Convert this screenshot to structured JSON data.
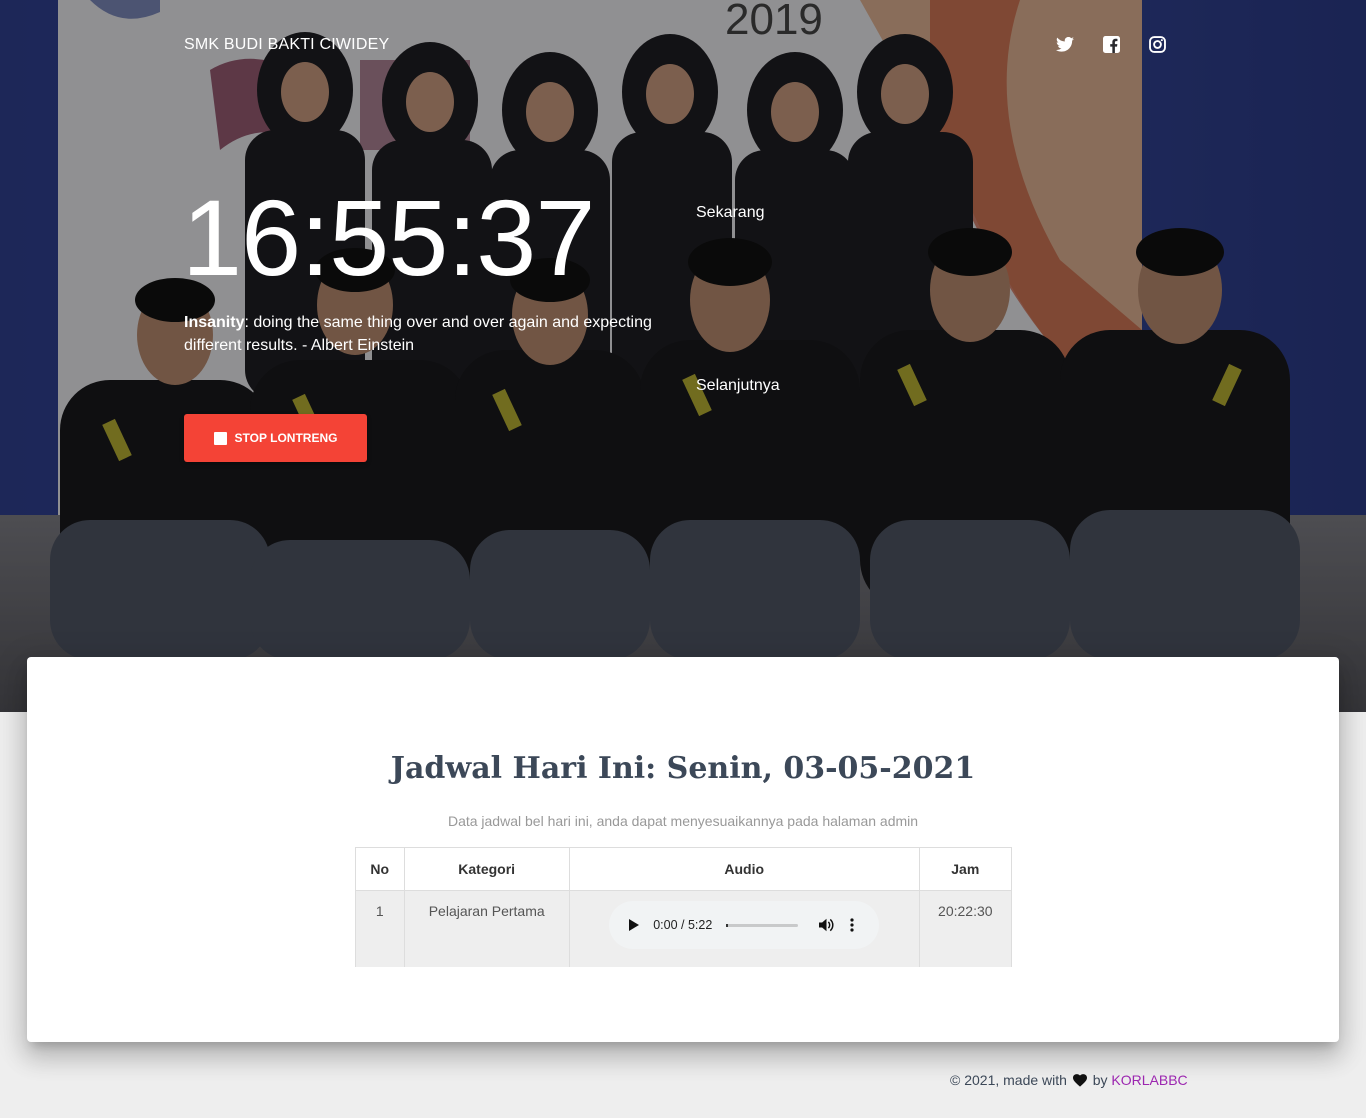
{
  "navbar": {
    "brand": "SMK BUDI BAKTI CIWIDEY",
    "social": [
      {
        "icon": "twitter-icon"
      },
      {
        "icon": "facebook-icon"
      },
      {
        "icon": "instagram-icon"
      }
    ]
  },
  "hero": {
    "background_image": "group photo of students in black uniforms in front of a banner reading 2019",
    "banner_year": "2019",
    "clock": "16:55:37",
    "label_now": "Sekarang",
    "label_next": "Selanjutnya",
    "quote": {
      "term": "Insanity",
      "text": ": doing the same thing over and over again and expecting different results. - Albert Einstein"
    },
    "stop_button": {
      "icon": "stop-icon",
      "label": "STOP LONTRENG",
      "color": "#f44336"
    }
  },
  "schedule": {
    "title": "Jadwal Hari Ini: Senin, 03-05-2021",
    "description": "Data jadwal bel hari ini, anda dapat menyesuaikannya pada halaman admin",
    "columns": [
      "No",
      "Kategori",
      "Audio",
      "Jam"
    ],
    "rows": [
      {
        "no": "1",
        "kategori": "Pelajaran Pertama",
        "audio": {
          "time": "0:00 / 5:22",
          "progress": 0
        },
        "jam": "20:22:30"
      }
    ]
  },
  "footer": {
    "prefix": "© 2021, made with",
    "by": "by",
    "author": "KORLABBC",
    "accent_color": "#9c27b0"
  }
}
